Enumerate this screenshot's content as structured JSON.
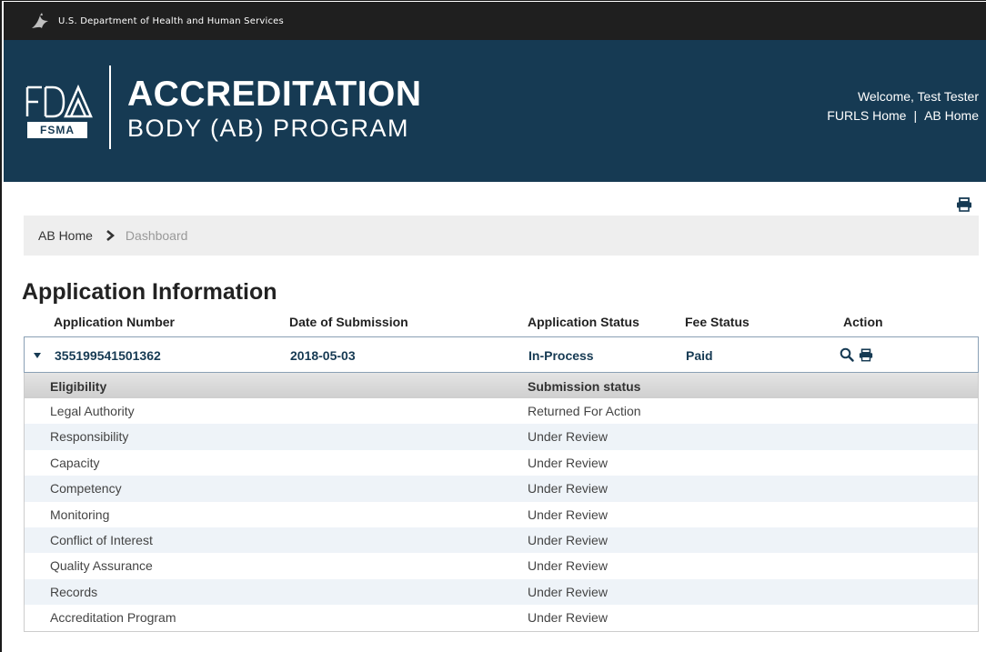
{
  "hhs_bar": {
    "text": "U.S. Department of Health and Human Services",
    "icon": "hhs-eagle-icon"
  },
  "banner": {
    "logo_fda": "FDA",
    "logo_fsma": "FSMA",
    "title_line1": "ACCREDITATION",
    "title_line2": "BODY (AB) PROGRAM",
    "welcome": "Welcome, Test Tester",
    "links": {
      "furls_home": "FURLS Home",
      "separator": "|",
      "ab_home": "AB Home"
    },
    "background_color": "#163a53"
  },
  "toolbar": {
    "print_icon": "print-icon"
  },
  "breadcrumb": {
    "home": "AB Home",
    "current": "Dashboard"
  },
  "section": {
    "title": "Application Information"
  },
  "table": {
    "headers": {
      "application_number": "Application Number",
      "date_of_submission": "Date of Submission",
      "application_status": "Application Status",
      "fee_status": "Fee Status",
      "action": "Action"
    },
    "application": {
      "number": "355199541501362",
      "date": "2018-05-03",
      "status": "In-Process",
      "fee_status": "Paid",
      "actions": [
        "search-icon",
        "print-icon"
      ],
      "expanded": true
    },
    "detail": {
      "headers": {
        "eligibility": "Eligibility",
        "submission_status": "Submission status"
      },
      "rows": [
        {
          "eligibility": "Legal Authority",
          "status": "Returned For Action"
        },
        {
          "eligibility": "Responsibility",
          "status": "Under Review"
        },
        {
          "eligibility": "Capacity",
          "status": "Under Review"
        },
        {
          "eligibility": "Competency",
          "status": "Under Review"
        },
        {
          "eligibility": "Monitoring",
          "status": "Under Review"
        },
        {
          "eligibility": "Conflict of Interest",
          "status": "Under Review"
        },
        {
          "eligibility": "Quality Assurance",
          "status": "Under Review"
        },
        {
          "eligibility": "Records",
          "status": "Under Review"
        },
        {
          "eligibility": "Accreditation Program",
          "status": "Under Review"
        }
      ]
    }
  }
}
